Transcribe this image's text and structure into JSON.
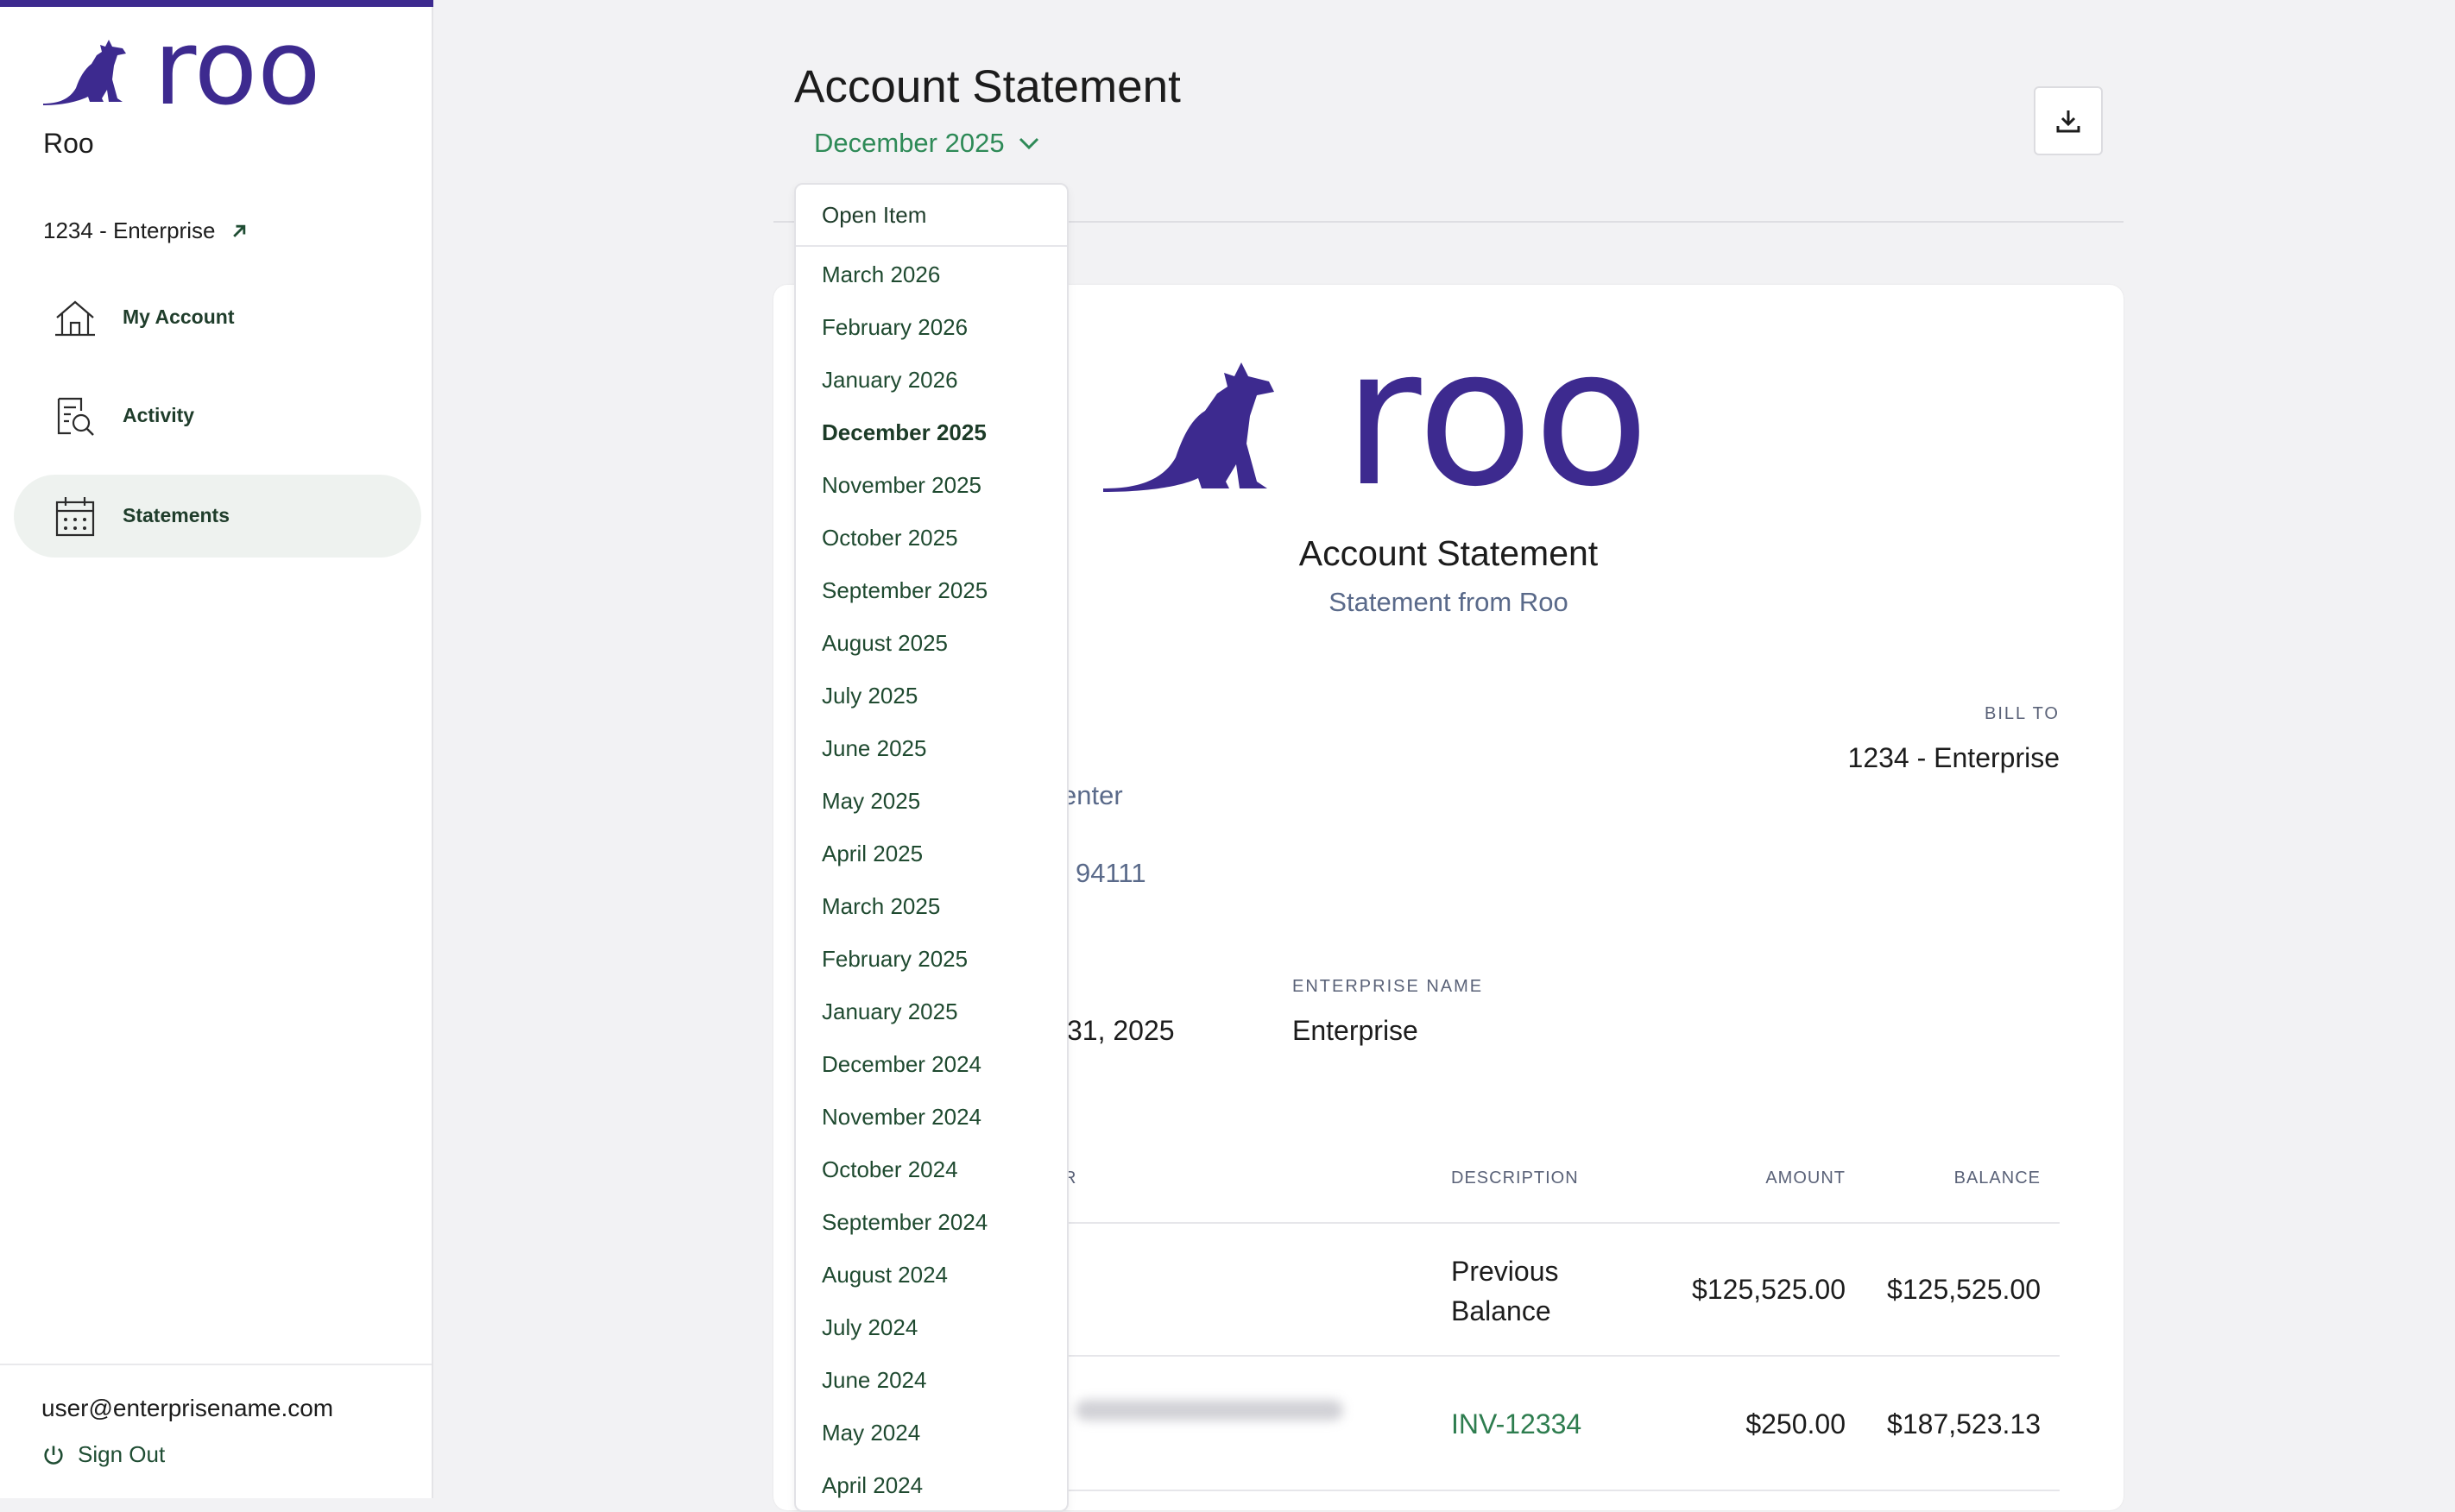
{
  "brand": {
    "logo_text": "roo",
    "name": "Roo",
    "accent_color": "#3d2a8f"
  },
  "sidebar": {
    "account_link": "1234 - Enterprise",
    "items": [
      {
        "label": "My Account",
        "icon": "home-icon"
      },
      {
        "label": "Activity",
        "icon": "document-search-icon"
      },
      {
        "label": "Statements",
        "icon": "calendar-icon",
        "active": true
      }
    ],
    "user_email": "user@enterprisename.com",
    "sign_out_label": "Sign Out"
  },
  "header": {
    "title": "Account Statement",
    "selected_month": "December 2025",
    "download_icon": "download-icon"
  },
  "dropdown": {
    "open_item_label": "Open Item",
    "options": [
      "March 2026",
      "February 2026",
      "January 2026",
      "December 2025",
      "November 2025",
      "October 2025",
      "September 2025",
      "August 2025",
      "July 2025",
      "June 2025",
      "May 2025",
      "April 2025",
      "March 2025",
      "February 2025",
      "January 2025",
      "December 2024",
      "November 2024",
      "October 2024",
      "September 2024",
      "August 2024",
      "July 2024",
      "June 2024",
      "May 2024",
      "April 2024"
    ],
    "selected": "December 2025"
  },
  "statement": {
    "logo_text": "roo",
    "title": "Account Statement",
    "subtitle": "Statement from Roo",
    "bill_to_label": "BILL TO",
    "bill_to_value": "1234 - Enterprise",
    "address_fragment_1": "enter",
    "address_fragment_2": "94111",
    "period_fragment": "31, 2025",
    "enterprise_name_label": "ENTERPRISE NAME",
    "enterprise_name_value": "Enterprise",
    "table": {
      "partial_header": "R",
      "headers": {
        "description": "DESCRIPTION",
        "amount": "AMOUNT",
        "balance": "BALANCE"
      },
      "rows": [
        {
          "description": "Previous Balance",
          "amount": "$125,525.00",
          "balance": "$125,525.00"
        },
        {
          "description": "INV-12334",
          "amount": "$250.00",
          "balance": "$187,523.13"
        }
      ]
    }
  }
}
